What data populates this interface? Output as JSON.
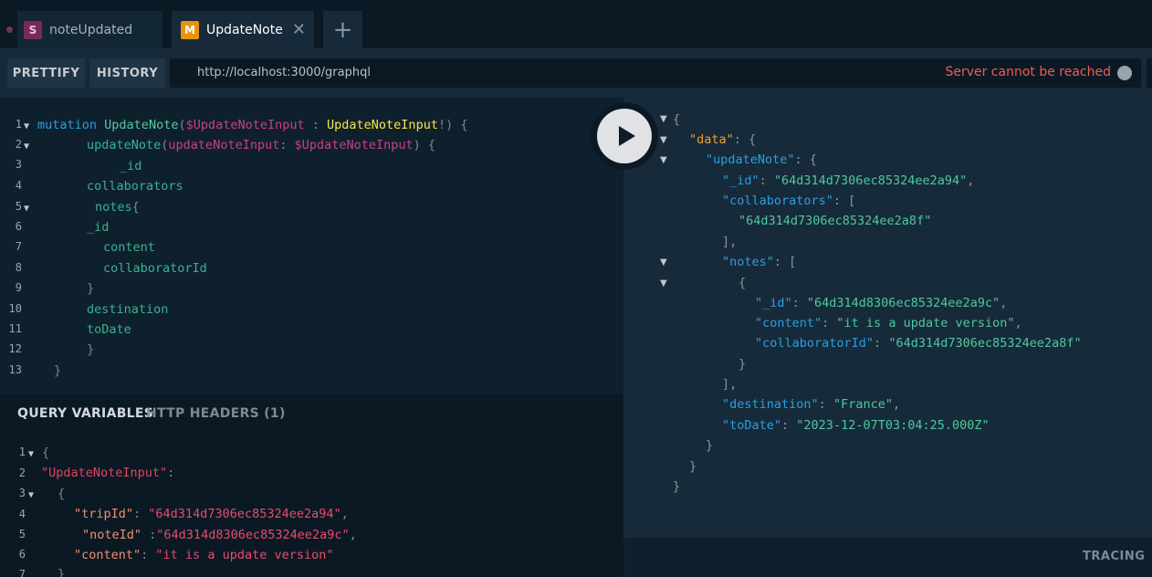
{
  "tabs": [
    {
      "badge": "S",
      "title": "noteUpdated"
    },
    {
      "badge": "M",
      "title": "UpdateNote",
      "close": "✕"
    }
  ],
  "add_tab": "+",
  "toolbar": {
    "prettify": "PRETTIFY",
    "history": "HISTORY",
    "url": "http://localhost:3000/graphql",
    "status": "Server cannot be reached"
  },
  "query": {
    "line_numbers": [
      "1",
      "2",
      "3",
      "4",
      "5",
      "6",
      "7",
      "8",
      "9",
      "10",
      "11",
      "12",
      "13"
    ],
    "l1": {
      "kw": "mutation",
      "name": "UpdateNote",
      "open": "(",
      "var": "$UpdateNoteInput",
      "colon": " : ",
      "type": "UpdateNoteInput",
      "bang_close": "!) {"
    },
    "l2": {
      "field": "updateNote",
      "open": "(",
      "arg": "updateNoteInput",
      "colon": ": ",
      "var": "$UpdateNoteInput",
      "close": ") {"
    },
    "l3": "_id",
    "l4": "collaborators",
    "l5": {
      "field": "notes",
      "brace": "{"
    },
    "l6": "_id",
    "l7": "content",
    "l8": "collaboratorId",
    "l9": "}",
    "l10": "destination",
    "l11": "toDate",
    "l12": "}",
    "l13": "}"
  },
  "vars_panel": {
    "tab_vars": "QUERY VARIABLES",
    "tab_headers": "HTTP HEADERS (1)",
    "line_numbers": [
      "1",
      "2",
      "3",
      "4",
      "5",
      "6",
      "7"
    ],
    "l1": "{",
    "l2": {
      "key": "\"UpdateNoteInput\"",
      "colon": ":"
    },
    "l3": "{",
    "l4": {
      "key": "\"tripId\"",
      "colon": ": ",
      "value": "\"64d314d7306ec85324ee2a94\"",
      "comma": ","
    },
    "l5": {
      "key": "\"noteId\"",
      "colon": " :",
      "value": "\"64d314d8306ec85324ee2a9c\"",
      "comma": ","
    },
    "l6": {
      "key": "\"content\"",
      "colon": ": ",
      "value": "\"it is a update version\""
    },
    "l7": "}"
  },
  "result": {
    "open": "{",
    "data_key": "\"data\"",
    "update_note_key": "\"updateNote\"",
    "id_key": "\"_id\"",
    "id_val": "\"64d314d7306ec85324ee2a94\"",
    "collaborators_key": "\"collaborators\"",
    "collaborator_val": "\"64d314d7306ec85324ee2a8f\"",
    "notes_key": "\"notes\"",
    "note_id_key": "\"_id\"",
    "note_id_val": "\"64d314d8306ec85324ee2a9c\"",
    "content_key": "\"content\"",
    "content_val": "\"it is a update version\"",
    "collab_id_key": "\"collaboratorId\"",
    "collab_id_val": "\"64d314d7306ec85324ee2a8f\"",
    "destination_key": "\"destination\"",
    "destination_val": "\"France\"",
    "to_date_key": "\"toDate\"",
    "to_date_val": "\"2023-12-07T03:04:25.000Z\""
  },
  "tracing": "TRACING",
  "colors": {
    "background": "#0f202d",
    "result_background": "#172a3a",
    "error": "#f25c54",
    "run_button": "#e0e2e5"
  },
  "icons": {
    "run": "play-icon",
    "close": "close-icon",
    "add": "plus-icon",
    "fold": "fold-arrow-icon",
    "status": "status-indicator-icon"
  }
}
